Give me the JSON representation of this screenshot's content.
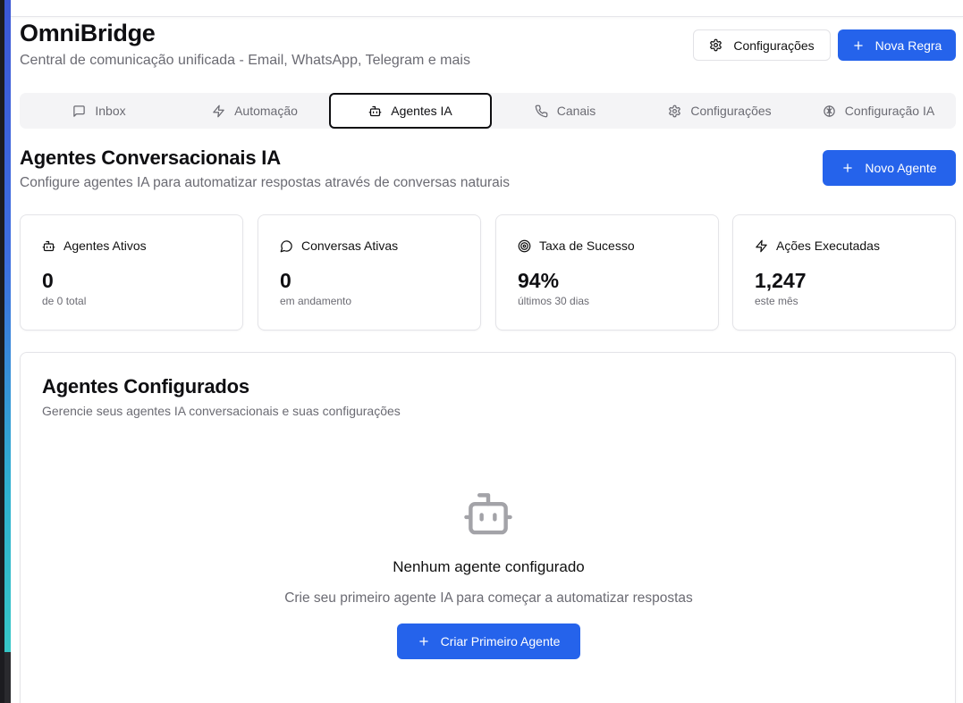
{
  "header": {
    "title": "OmniBridge",
    "subtitle": "Central de comunicação unificada - Email, WhatsApp, Telegram e mais",
    "settings_button": "Configurações",
    "new_rule_button": "Nova Regra"
  },
  "tabs": [
    {
      "label": "Inbox",
      "icon": "message-square-icon"
    },
    {
      "label": "Automação",
      "icon": "zap-icon"
    },
    {
      "label": "Agentes IA",
      "icon": "bot-icon",
      "active": true
    },
    {
      "label": "Canais",
      "icon": "phone-icon"
    },
    {
      "label": "Configurações",
      "icon": "gear-icon"
    },
    {
      "label": "Configuração IA",
      "icon": "brain-icon"
    }
  ],
  "section": {
    "title": "Agentes Conversacionais IA",
    "subtitle": "Configure agentes IA para automatizar respostas através de conversas naturais",
    "new_agent_button": "Novo Agente"
  },
  "stats": [
    {
      "label": "Agentes Ativos",
      "value": "0",
      "sub": "de 0 total",
      "icon": "bot-icon"
    },
    {
      "label": "Conversas Ativas",
      "value": "0",
      "sub": "em andamento",
      "icon": "message-circle-icon"
    },
    {
      "label": "Taxa de Sucesso",
      "value": "94%",
      "sub": "últimos 30 dias",
      "icon": "target-icon"
    },
    {
      "label": "Ações Executadas",
      "value": "1,247",
      "sub": "este mês",
      "icon": "zap-icon"
    }
  ],
  "agents_panel": {
    "title": "Agentes Configurados",
    "subtitle": "Gerencie seus agentes IA conversacionais e suas configurações",
    "empty_title": "Nenhum agente configurado",
    "empty_subtitle": "Crie seu primeiro agente IA para começar a automatizar respostas",
    "create_button": "Criar Primeiro Agente"
  },
  "colors": {
    "primary": "#2563eb",
    "muted_text": "#6b6b73",
    "tab_background": "#f4f4f6"
  }
}
